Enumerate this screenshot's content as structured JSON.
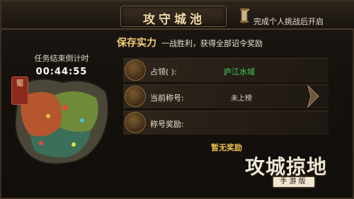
{
  "header": {
    "title": "攻守城池",
    "quest_text": "完成个人挑战后开启"
  },
  "timer": {
    "label": "任务结束倒计时",
    "value": "00:44:55"
  },
  "map": {
    "seal_text": "蜀"
  },
  "section": {
    "title": "保存实力",
    "description": "一战胜利，获得全部诏令奖励"
  },
  "rows": [
    {
      "label": "占领(            ):",
      "value": "庐江水域",
      "icon": "scroll-icon"
    },
    {
      "label": "当前称号:",
      "value": "未上榜",
      "icon": "banner-icon"
    },
    {
      "label": "称号奖励:",
      "value": "",
      "icon": "chest-icon"
    }
  ],
  "reward_empty": "暂无奖励",
  "logo": {
    "main": "攻城掠地",
    "sub": "手游版"
  },
  "colors": {
    "accent_gold": "#f2c97a",
    "value_green": "#3fd05a",
    "reward_yellow": "#f0c24c"
  }
}
